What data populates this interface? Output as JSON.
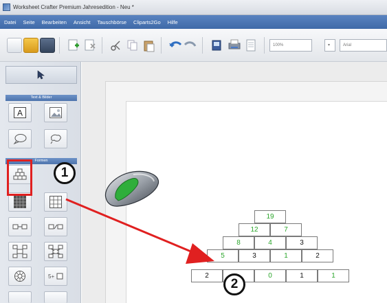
{
  "window": {
    "title": "Worksheet Crafter Premium Jahresedition - Neu *"
  },
  "menu": [
    "Datei",
    "Seite",
    "Bearbeiten",
    "Ansicht",
    "Tauschbörse",
    "Cliparts2Go",
    "Hilfe"
  ],
  "toolbar": {
    "zoom_value": "100%",
    "font_value": "Arial"
  },
  "left_panel": {
    "section_text_images": "Text & Bilder",
    "section_shapes": "Formen"
  },
  "callouts": {
    "step1": "1",
    "step2": "2"
  },
  "number_pyramid": {
    "rows": [
      [
        "19"
      ],
      [
        "12",
        "7"
      ],
      [
        "8",
        "4",
        "3"
      ],
      [
        "5",
        "3",
        "1",
        "2"
      ],
      [
        "2",
        "",
        "0",
        "1",
        "1"
      ]
    ]
  },
  "colors": {
    "accent_red": "#e02020",
    "pyramid_green": "#2aa52a",
    "menu_blue": "#4a74b2"
  }
}
